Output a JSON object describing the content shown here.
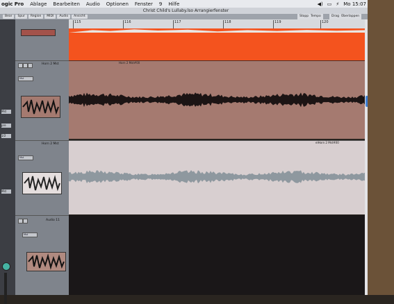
{
  "menu": {
    "app": "ogic Pro",
    "items": [
      "Ablage",
      "Bearbeiten",
      "Audio",
      "Optionen",
      "Fenster",
      "9",
      "Hilfe"
    ],
    "clock": "Mo 15:07",
    "status_glyphs": [
      "◀)",
      "▭",
      "⚡"
    ]
  },
  "window": {
    "title": "Christ Child's Lullaby.lso Arrangierfenster"
  },
  "toolbar": {
    "left_buttons": [
      "Bear",
      "Spur",
      "Region",
      "MIDI",
      "Audio",
      "Ansicht"
    ],
    "right_buttons": [
      "Stopp",
      "Tempo",
      "Drag",
      "Überlappen"
    ]
  },
  "ruler": {
    "bars": [
      "115",
      "116",
      "117",
      "118",
      "119",
      "120"
    ]
  },
  "tracks": [
    {
      "name": "",
      "color": "#f4531e"
    },
    {
      "name": "Horn 2 Mst",
      "region_label": "Horn 2 Mst#00",
      "menu": "Mst",
      "color": "#a57a70"
    },
    {
      "name": "Horn 2 Mst",
      "region_label": "elHorn 2 Mst#00",
      "menu": "Mst",
      "color": "#d8cfd0"
    },
    {
      "name": "Audio 11",
      "menu": "Mst",
      "color": "#1a1718"
    }
  ],
  "mixer": {
    "labels": [
      "Mst",
      "pre",
      "1/2",
      "Mst"
    ]
  },
  "colors": {
    "orange": "#f4531e",
    "brown": "#a57a70",
    "light": "#d8cfd0",
    "blue": "#3d7fd6"
  }
}
